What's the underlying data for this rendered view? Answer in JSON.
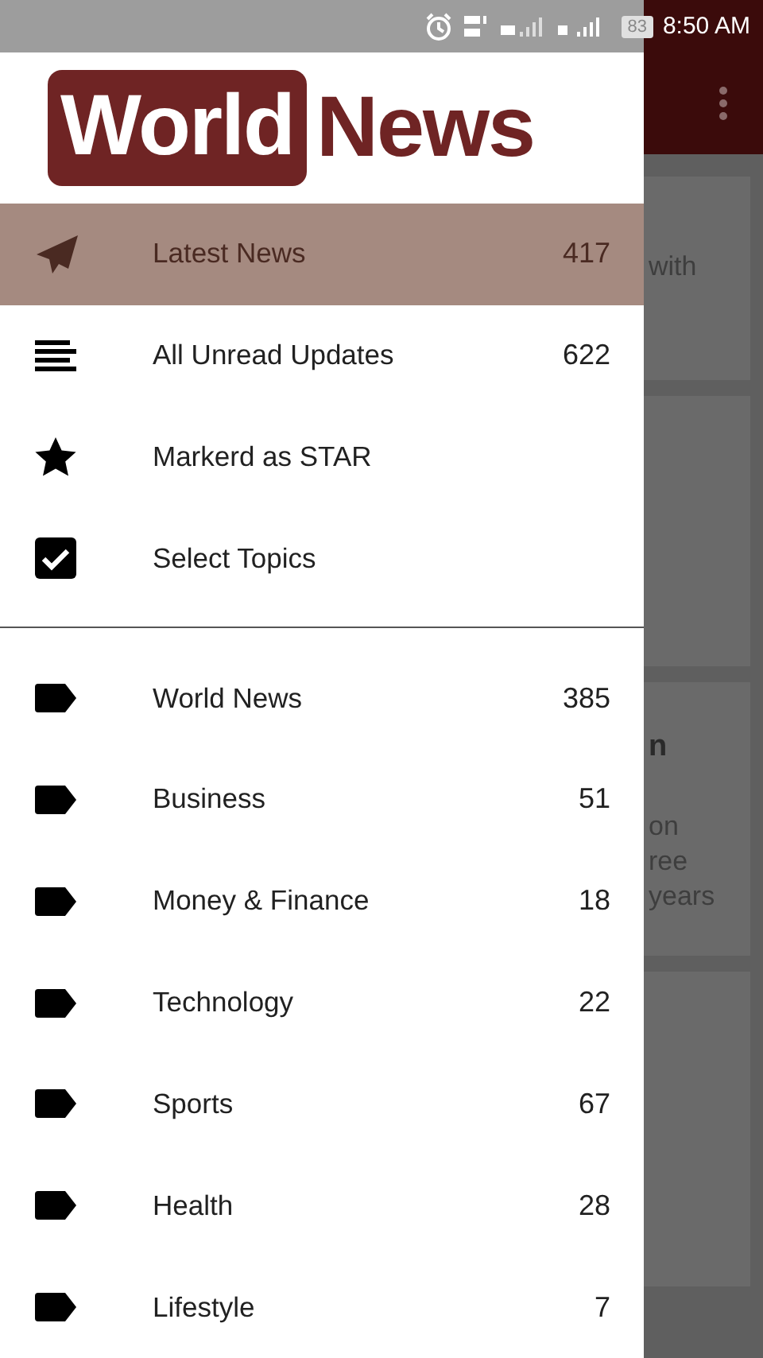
{
  "status_bar": {
    "battery": "83",
    "time": "8:50 AM"
  },
  "logo": {
    "first": "World",
    "second": "News"
  },
  "menu": [
    {
      "label": "Latest News",
      "count": "417",
      "kind": "send",
      "selected": true
    },
    {
      "label": "All Unread Updates",
      "count": "622",
      "kind": "lines",
      "selected": false
    },
    {
      "label": "Markerd as STAR",
      "kind": "star",
      "selected": false
    },
    {
      "label": "Select Topics",
      "kind": "checkbox",
      "selected": false
    }
  ],
  "topics": [
    {
      "label": "World News",
      "count": "385"
    },
    {
      "label": "Business",
      "count": "51"
    },
    {
      "label": "Money & Finance",
      "count": "18"
    },
    {
      "label": "Technology",
      "count": "22"
    },
    {
      "label": "Sports",
      "count": "67"
    },
    {
      "label": "Health",
      "count": "28"
    },
    {
      "label": "Lifestyle",
      "count": "7"
    }
  ],
  "background_cards": [
    {
      "kind": "text",
      "lines": [
        {
          "text": "with",
          "kind": "body"
        }
      ]
    },
    {
      "kind": "plain"
    },
    {
      "kind": "text",
      "lines": [
        {
          "text": "n",
          "kind": "title"
        },
        {
          "text": "on",
          "kind": "body"
        },
        {
          "text": "ree",
          "kind": "body"
        },
        {
          "text": "years",
          "kind": "body"
        }
      ]
    },
    {
      "kind": "plain"
    }
  ]
}
